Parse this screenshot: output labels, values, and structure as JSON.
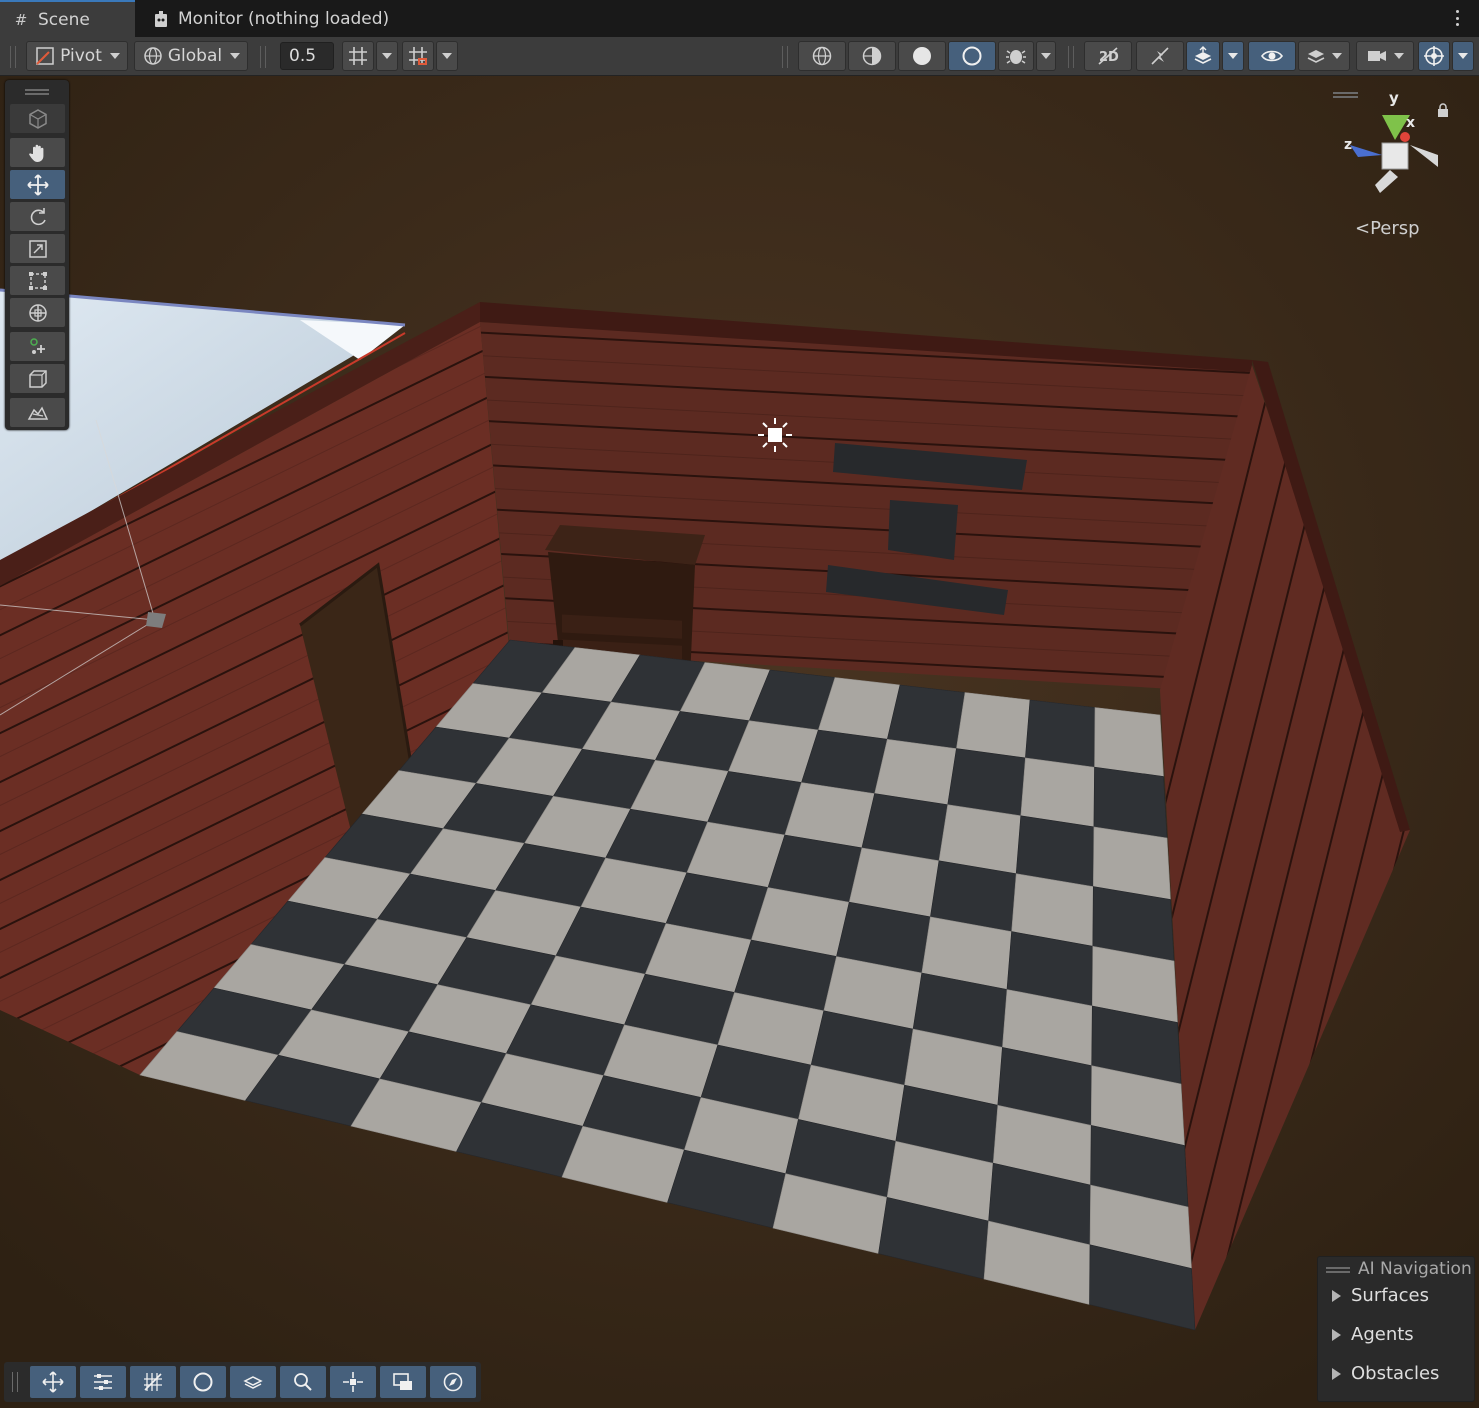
{
  "tabs": [
    {
      "label": "Scene",
      "icon": "scene-grid-icon",
      "active": true
    },
    {
      "label": "Monitor (nothing loaded)",
      "icon": "monitor-icon",
      "active": false
    }
  ],
  "toolbar": {
    "pivot_label": "Pivot",
    "global_label": "Global",
    "snap_value": "0.5"
  },
  "tools": [
    "view-2d-3d-cube-icon",
    "hand-icon",
    "move-icon",
    "rotate-icon",
    "scale-icon",
    "rect-icon",
    "transform-icon",
    "custom-tool-icon",
    "box-collider-icon",
    "navmesh-tool-icon"
  ],
  "gizmo": {
    "axis_y": "y",
    "axis_x": "x",
    "axis_z": "z",
    "projection_label": "Persp"
  },
  "ai_navigation": {
    "title": "AI Navigation",
    "items": [
      "Surfaces",
      "Agents",
      "Obstacles"
    ]
  },
  "overlay_tools": [
    "move-icon",
    "sliders-icon",
    "grid-snap-icon",
    "moon-icon",
    "layers-icon",
    "search-icon",
    "pivot-icon",
    "camera-icon",
    "compass-icon"
  ],
  "colors": {
    "accent": "#46607c",
    "tab_highlight": "#3a79bb",
    "background": "#3a2b1b",
    "wood": "#6a2c22"
  }
}
